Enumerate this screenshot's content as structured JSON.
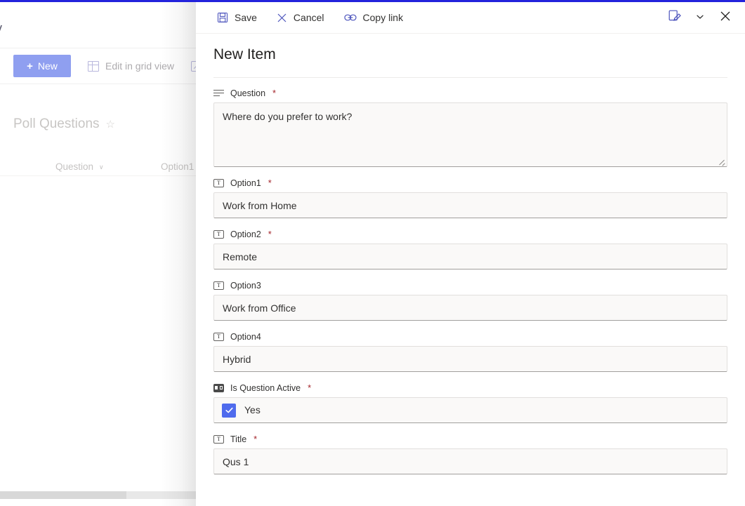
{
  "background": {
    "suite_text_cut": "v",
    "command_bar": {
      "new_label": "New",
      "new_plus": "+",
      "edit_grid_label": "Edit in grid view"
    },
    "list_title": "Poll Questions",
    "star_glyph": "☆",
    "columns": [
      {
        "label": "Question",
        "sort_glyph": "∨"
      },
      {
        "label": "Option1"
      }
    ]
  },
  "panel": {
    "toolbar": {
      "save_label": "Save",
      "cancel_label": "Cancel",
      "copy_link_label": "Copy link",
      "chevron_glyph": "⌄"
    },
    "heading": "New Item",
    "fields": [
      {
        "name": "Question",
        "label": "Question",
        "required": "*",
        "icon": "multiline-text-icon",
        "type": "textarea",
        "value": "Where do you prefer to work?"
      },
      {
        "name": "Option1",
        "label": "Option1",
        "required": "*",
        "icon": "single-line-text-icon",
        "type": "text",
        "value": "Work from Home"
      },
      {
        "name": "Option2",
        "label": "Option2",
        "required": "*",
        "icon": "single-line-text-icon",
        "type": "text",
        "value": "Remote"
      },
      {
        "name": "Option3",
        "label": "Option3",
        "required": "",
        "icon": "single-line-text-icon",
        "type": "text",
        "value": "Work from Office"
      },
      {
        "name": "Option4",
        "label": "Option4",
        "required": "",
        "icon": "single-line-text-icon",
        "type": "text",
        "value": "Hybrid"
      },
      {
        "name": "IsQuestionActive",
        "label": "Is Question Active",
        "required": "*",
        "icon": "yes-no-icon",
        "type": "checkbox",
        "value": "Yes",
        "checked": true
      },
      {
        "name": "Title",
        "label": "Title",
        "required": "*",
        "icon": "single-line-text-icon",
        "type": "text",
        "value": "Qus 1"
      }
    ]
  },
  "colors": {
    "accent_purple": "#4b53bc",
    "new_button": "#8f9ff0",
    "checkbox_blue": "#4f6bed",
    "required_red": "#a4262c",
    "top_strip": "#2323dc"
  }
}
